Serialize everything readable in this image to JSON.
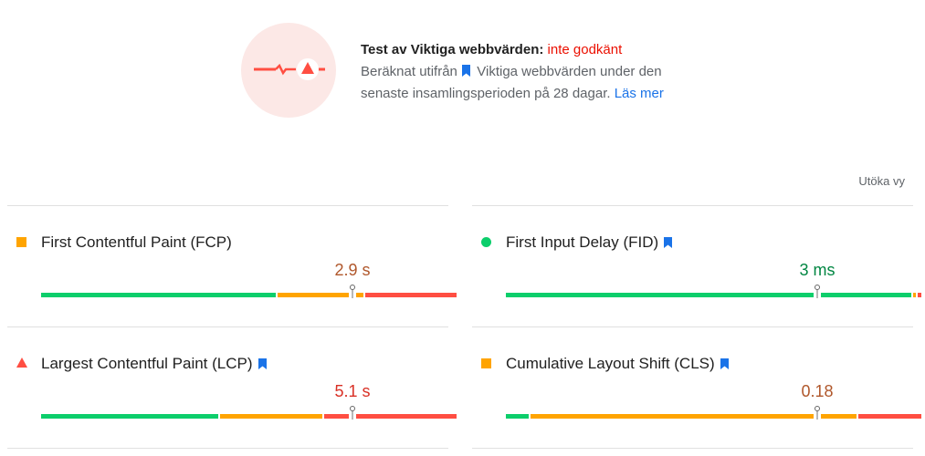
{
  "summary": {
    "title": "Test av Viktiga webbvärden:",
    "verdict": "inte godkänt",
    "description_before": "Beräknat utifrån",
    "description_after": "Viktiga webbvärden under den senaste insamlingsperioden på 28 dagar.",
    "learn_more": "Läs mer"
  },
  "expand_view": "Utöka vy",
  "colors": {
    "good": "#0cce6b",
    "average": "#ffa400",
    "poor": "#ff4e42",
    "link": "#1a73e8"
  },
  "metrics": [
    {
      "label": "First Contentful Paint (FCP)",
      "value": "2.9 s",
      "rating": "average",
      "marker_shape": "square",
      "core": false,
      "distribution": {
        "good": 0.57,
        "average": 0.21,
        "poor": 0.22
      },
      "percentile_position": 0.75
    },
    {
      "label": "First Input Delay (FID)",
      "value": "3 ms",
      "rating": "good",
      "marker_shape": "circle",
      "core": true,
      "distribution": {
        "good": 0.98,
        "average": 0.01,
        "poor": 0.01
      },
      "percentile_position": 0.75
    },
    {
      "label": "Largest Contentful Paint (LCP)",
      "value": "5.1 s",
      "rating": "poor",
      "marker_shape": "triangle",
      "core": true,
      "distribution": {
        "good": 0.43,
        "average": 0.25,
        "poor": 0.32
      },
      "percentile_position": 0.75
    },
    {
      "label": "Cumulative Layout Shift (CLS)",
      "value": "0.18",
      "rating": "average",
      "marker_shape": "square",
      "core": true,
      "distribution": {
        "good": 0.06,
        "average": 0.79,
        "poor": 0.15
      },
      "percentile_position": 0.75
    }
  ]
}
